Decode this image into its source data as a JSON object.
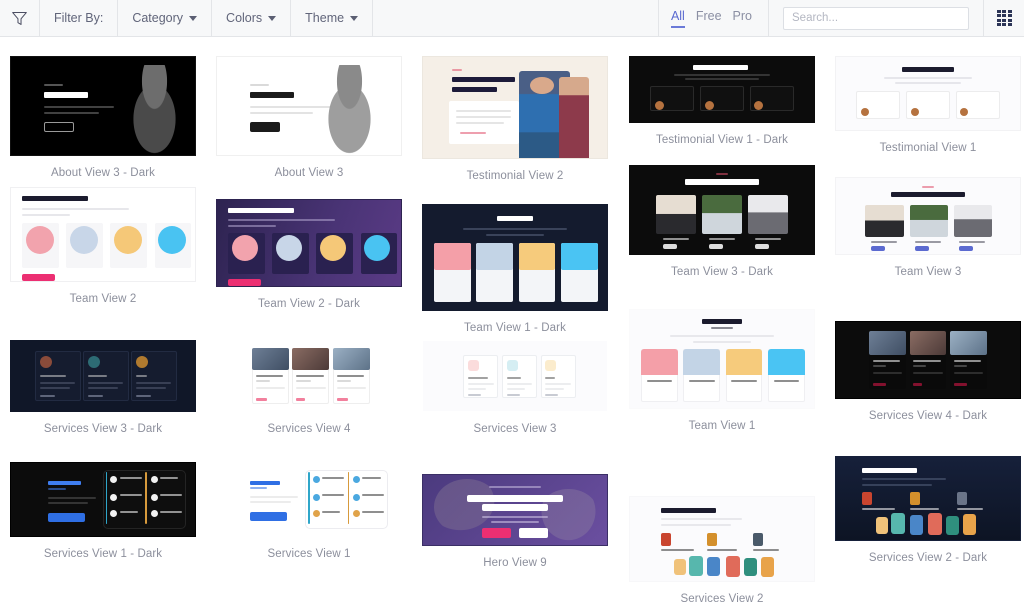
{
  "toolbar": {
    "filter_icon": "funnel-icon",
    "filter_label": "Filter By:",
    "dropdowns": [
      {
        "label": "Category"
      },
      {
        "label": "Colors"
      },
      {
        "label": "Theme"
      }
    ],
    "tabs": [
      {
        "label": "All",
        "active": true
      },
      {
        "label": "Free",
        "active": false
      },
      {
        "label": "Pro",
        "active": false
      }
    ],
    "search": {
      "value": "",
      "placeholder": "Search..."
    },
    "view_toggle_icon": "grid-view-icon",
    "accent_color": "#5a6ad0",
    "bar_background": "#f7f8f9"
  },
  "gallery": {
    "columns": 5,
    "items": [
      {
        "caption": "About View 3 - Dark",
        "style": "about-dark",
        "col": 0,
        "row": 0
      },
      {
        "caption": "About View 3",
        "style": "about-light",
        "col": 1,
        "row": 0
      },
      {
        "caption": "Testimonial View 2",
        "style": "testi2",
        "col": 2,
        "row": 0
      },
      {
        "caption": "Testimonial View 1 - Dark",
        "style": "testi1-dark",
        "col": 3,
        "row": 0
      },
      {
        "caption": "Testimonial View 1",
        "style": "testi1-light",
        "col": 4,
        "row": 0
      },
      {
        "caption": "Team View 2",
        "style": "team2-light",
        "col": 0,
        "row": 1
      },
      {
        "caption": "Team View 2 - Dark",
        "style": "team2-dark",
        "col": 1,
        "row": 1
      },
      {
        "caption": "Team View 1 - Dark",
        "style": "team1-dark",
        "col": 2,
        "row": 1
      },
      {
        "caption": "Team View 3 - Dark",
        "style": "team3-dark",
        "col": 3,
        "row": 1
      },
      {
        "caption": "Team View 3",
        "style": "team3-light",
        "col": 4,
        "row": 1
      },
      {
        "caption": "Services View 3 - Dark",
        "style": "serv3-dark",
        "col": 0,
        "row": 2
      },
      {
        "caption": "Services View 4",
        "style": "serv4-light",
        "col": 1,
        "row": 2
      },
      {
        "caption": "Services View 3",
        "style": "serv3-light",
        "col": 2,
        "row": 2
      },
      {
        "caption": "Team View 1",
        "style": "team1-light",
        "col": 3,
        "row": 2
      },
      {
        "caption": "Services View 4 - Dark",
        "style": "serv4-dark",
        "col": 4,
        "row": 2
      },
      {
        "caption": "Services View 1 - Dark",
        "style": "serv1-dark",
        "col": 0,
        "row": 3
      },
      {
        "caption": "Services View 1",
        "style": "serv1-light",
        "col": 1,
        "row": 3
      },
      {
        "caption": "Hero View 9",
        "style": "hero9",
        "col": 2,
        "row": 3
      },
      {
        "caption": "Services View 2",
        "style": "serv2-light",
        "col": 3,
        "row": 3
      },
      {
        "caption": "Services View 2 - Dark",
        "style": "serv2-dark",
        "col": 4,
        "row": 3
      }
    ],
    "thumbnail_texts": {
      "about_eyebrow": "HELLO I AM",
      "about_name": "JOHN JORDAN",
      "about_button": "READ MORE",
      "testi2_title": "Our Students Parents\nSay About Us",
      "testi1_title": "Client's Testimonial",
      "team2_title": "Heros Behind Our Brand",
      "team1_title": "Our Superheros",
      "team3_title": "Our Passionate Teachers",
      "serv1_title": "Our Services",
      "serv2_title": "Choose Your Service",
      "hero9_title": "Best Experience Learning\nUniversity For You",
      "member_names": [
        "Raymond Smith",
        "Richard Kalanga",
        "Jacob Bulawa",
        "William Pestos"
      ],
      "teacher_names": [
        "Murphy Turner",
        "Mary Wagner",
        "Aron Golden"
      ],
      "service_names": [
        "Web Design",
        "Design",
        "SEO"
      ],
      "course_names": [
        "Social Networking Course",
        "Business Decision Making",
        "Machine Learning Management"
      ]
    }
  }
}
